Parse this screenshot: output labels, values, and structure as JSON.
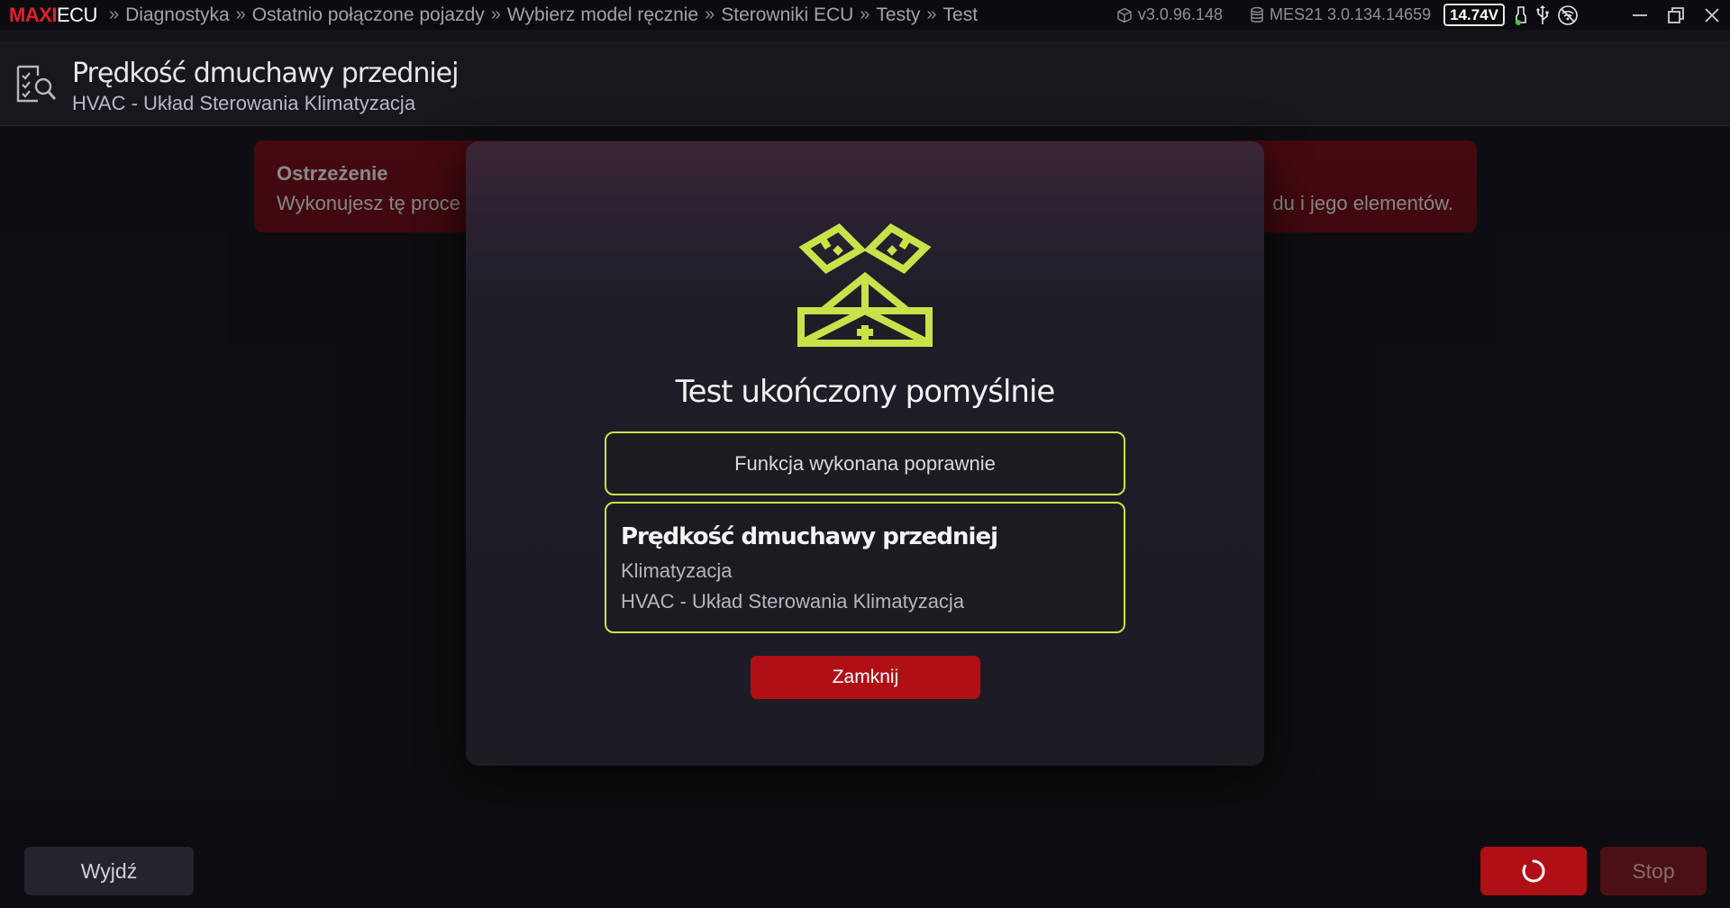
{
  "titlebar": {
    "brand_maxi": "MAXI",
    "brand_ecu": "ECU",
    "breadcrumbs": [
      "Diagnostyka",
      "Ostatnio połączone pojazdy",
      "Wybierz model ręcznie",
      "Sterowniki ECU",
      "Testy",
      "Test"
    ],
    "app_version": "v3.0.96.148",
    "db_version": "MES21 3.0.134.14659",
    "voltage": "14.74V"
  },
  "page": {
    "title": "Prędkość dmuchawy przedniej",
    "subtitle": "HVAC - Układ Sterowania Klimatyzacja"
  },
  "warning": {
    "title": "Ostrzeżenie",
    "text": "Wykonujesz tę proce",
    "text_tail": "du i jego elementów."
  },
  "modal": {
    "title": "Test ukończony pomyślnie",
    "result": "Funkcja wykonana poprawnie",
    "info_title": "Prędkość dmuchawy przedniej",
    "info_line1": "Klimatyzacja",
    "info_line2": "HVAC - Układ Sterowania Klimatyzacja",
    "close_label": "Zamknij"
  },
  "footer": {
    "exit_label": "Wyjdź",
    "stop_label": "Stop"
  },
  "colors": {
    "accent_green": "#c8e24a",
    "brand_red": "#e1202a",
    "button_red": "#b00f16"
  }
}
